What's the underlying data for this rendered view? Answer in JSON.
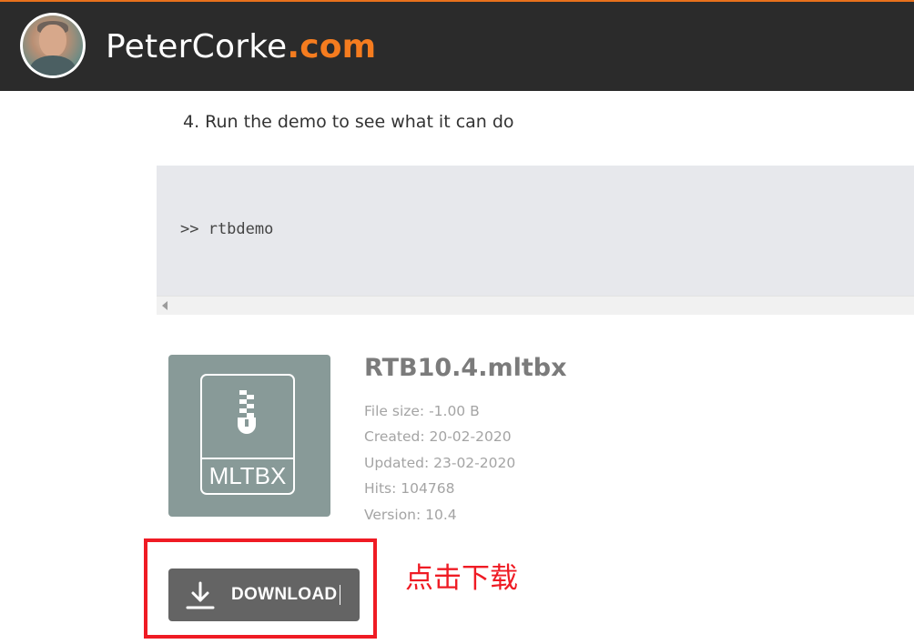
{
  "header": {
    "brand_name": "PeterCorke",
    "brand_tld": ".com"
  },
  "content": {
    "step_text": "4. Run the demo to see what it can do",
    "code": ">> rtbdemo"
  },
  "file": {
    "icon_ext": "MLTBX",
    "name": "RTB10.4.mltbx",
    "size": "File size: -1.00 B",
    "created": "Created: 20-02-2020",
    "updated": "Updated: 23-02-2020",
    "hits": "Hits: 104768",
    "version": "Version: 10.4"
  },
  "download": {
    "label": "DOWNLOAD",
    "annotation": "点击下载"
  },
  "colors": {
    "header_bg": "#2b2b2b",
    "brand_accent": "#f57c1f",
    "file_icon_bg": "#889a98",
    "button_bg": "#646464",
    "highlight_red": "#ef1b24"
  }
}
